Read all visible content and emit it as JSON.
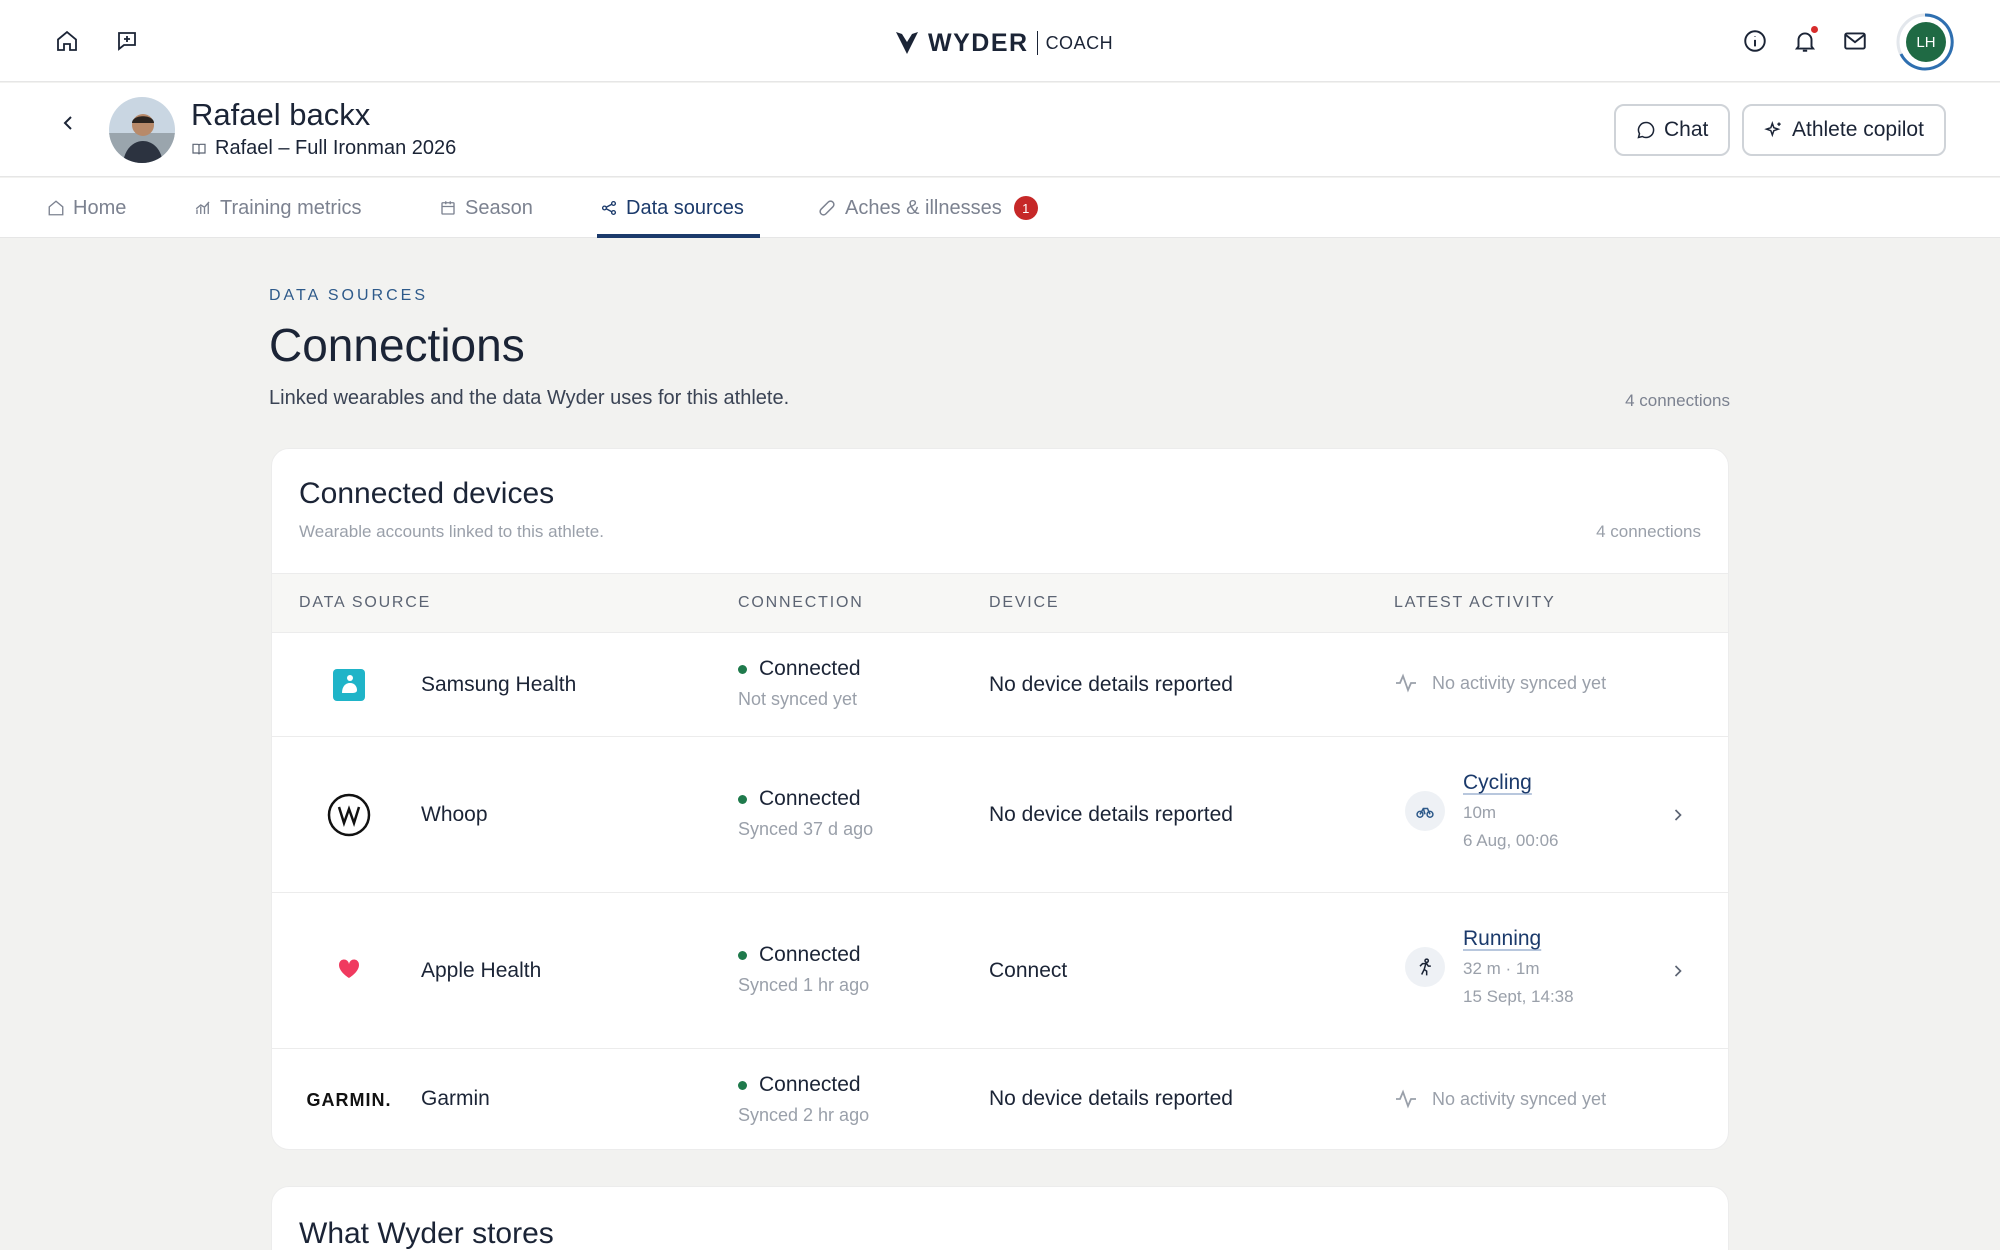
{
  "topbar": {
    "brand": "WYDER",
    "brand_sub": "COACH",
    "user_initials": "LH",
    "icons": [
      "home-icon",
      "chat-plus-icon",
      "info-icon",
      "bell-icon",
      "mail-icon"
    ]
  },
  "athlete": {
    "name": "Rafael backx",
    "plan": "Rafael – Full Ironman 2026",
    "chat_label": "Chat",
    "copilot_label": "Athlete copilot"
  },
  "tabs": [
    {
      "label": "Home",
      "icon": "home-icon"
    },
    {
      "label": "Training metrics",
      "icon": "bar-chart-icon"
    },
    {
      "label": "Season",
      "icon": "calendar-icon"
    },
    {
      "label": "Data sources",
      "icon": "data-sources-icon",
      "active": true
    },
    {
      "label": "Aches & illnesses",
      "icon": "bandage-icon",
      "badge": "1"
    }
  ],
  "page": {
    "eyebrow": "DATA SOURCES",
    "title": "Connections",
    "description": "Linked wearables and the data Wyder uses for this athlete.",
    "count": "4 connections"
  },
  "devices_card": {
    "title": "Connected devices",
    "subtitle": "Wearable accounts linked to this athlete.",
    "count": "4 connections",
    "columns": [
      "DATA SOURCE",
      "CONNECTION",
      "DEVICE",
      "LATEST ACTIVITY"
    ],
    "rows": [
      {
        "source": "Samsung Health",
        "status": "Connected",
        "sync": "Not synced yet",
        "device": "No device details reported",
        "activity_empty": "No activity synced yet"
      },
      {
        "source": "Whoop",
        "status": "Connected",
        "sync": "Synced 37 d ago",
        "device": "No device details reported",
        "activity": {
          "name": "Cycling",
          "duration": "10m",
          "date": "6 Aug, 00:06",
          "icon": "bike-icon"
        }
      },
      {
        "source": "Apple Health",
        "status": "Connected",
        "sync": "Synced 1 hr ago",
        "device": "Connect",
        "activity": {
          "name": "Running",
          "duration": "32 m · 1m",
          "date": "15 Sept, 14:38",
          "icon": "running-icon"
        }
      },
      {
        "source": "Garmin",
        "logo_text": "GARMIN.",
        "status": "Connected",
        "sync": "Synced 2 hr ago",
        "device": "No device details reported",
        "activity_empty": "No activity synced yet"
      }
    ]
  },
  "stores_card": {
    "title": "What Wyder stores"
  },
  "colors": {
    "accent": "#1b3a6b",
    "connected": "#1f7a4c",
    "badge": "#c62828",
    "page_bg": "#f2f2f0"
  }
}
